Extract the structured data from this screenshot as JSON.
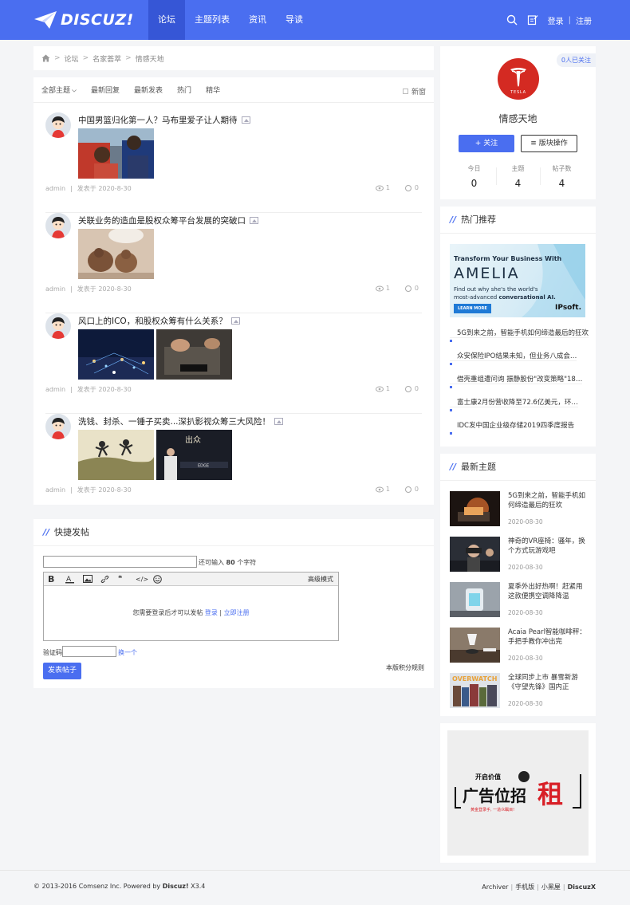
{
  "header": {
    "logo_text": "DISCUZ!",
    "nav": [
      {
        "label": "论坛",
        "active": true
      },
      {
        "label": "主题列表",
        "active": false
      },
      {
        "label": "资讯",
        "active": false
      },
      {
        "label": "导读",
        "active": false
      }
    ],
    "login": "登录",
    "register": "注册",
    "separator": "|",
    "search_icon": "search-icon",
    "post_icon": "edit-icon"
  },
  "breadcrumb": {
    "items": [
      "论坛",
      "名家荟萃",
      "情感天地"
    ],
    "sep": ">"
  },
  "filters": {
    "tabs": [
      "全部主题",
      "最新回复",
      "最新发表",
      "热门",
      "精华"
    ],
    "newest": "新窗"
  },
  "threads": [
    {
      "title": "中国男篮归化第一人？马布里爱子让人期待",
      "author": "admin",
      "date": "发表于 2020-8-30",
      "views": "1",
      "replies": "0"
    },
    {
      "title": "关联业务的造血是股权众筹平台发展的突破口",
      "author": "admin",
      "date": "发表于 2020-8-30",
      "views": "1",
      "replies": "0"
    },
    {
      "title": "风口上的ICO，和股权众筹有什么关系？",
      "author": "admin",
      "date": "发表于 2020-8-30",
      "views": "1",
      "replies": "0"
    },
    {
      "title": "洗钱、封杀、一锤子买卖...深扒影视众筹三大风险！",
      "author": "admin",
      "date": "发表于 2020-8-30",
      "views": "1",
      "replies": "0"
    }
  ],
  "quick_post": {
    "title": "快捷发帖",
    "remain_prefix": "还可输入",
    "remain_count": "80",
    "remain_suffix": "个字符",
    "advanced": "高级模式",
    "login_msg": "您需要登录后才可以发帖",
    "login_link": "登录",
    "sep": "|",
    "register_link": "立即注册",
    "captcha_label": "验证码",
    "captcha_refresh": "换一个",
    "rules": "本版积分规则",
    "submit": "发表帖子"
  },
  "forum": {
    "followers": "0人已关注",
    "logo_text": "TESLA",
    "name": "情感天地",
    "follow": "+ 关注",
    "ops": "≡ 版块操作",
    "stats": [
      {
        "label": "今日",
        "value": "0"
      },
      {
        "label": "主题",
        "value": "4"
      },
      {
        "label": "帖子数",
        "value": "4"
      }
    ]
  },
  "hot": {
    "title": "热门推荐",
    "banner": {
      "line1": "Transform Your Business With",
      "brand": "AMELIA",
      "line3a": "Find out why she's the world's",
      "line3b": "most-advanced",
      "line3c": "conversational AI.",
      "cta": "LEARN MORE",
      "company": "IPsoft."
    },
    "items": [
      "5G到来之前，智能手机如何缔造最后的狂欢",
      "众安保险IPO结果未知，但业务八成会…",
      "借壳重组遭问询 振静股份\"改变策略\"18…",
      "富士康2月份营收降至72.6亿美元，环…",
      "IDC发中国企业级存储2019四季度报告"
    ]
  },
  "latest": {
    "title": "最新主题",
    "items": [
      {
        "title": "5G到来之前，智能手机如何缔造最后的狂欢",
        "date": "2020-08-30"
      },
      {
        "title": "神奇的VR座椅：骚年，换个方式玩游戏吧",
        "date": "2020-08-30"
      },
      {
        "title": "夏季外出好热啊！赶紧用这款便携空调降降温",
        "date": "2020-08-30"
      },
      {
        "title": "Acaia Pearl智能咖啡秤：手把手教你冲出完",
        "date": "2020-08-30"
      },
      {
        "title": "全球同步上市 暴雪新游《守望先锋》国内正",
        "date": "2020-08-30"
      }
    ]
  },
  "ad": {
    "small": "开启价值",
    "main": "广告位招",
    "big": "租",
    "sub": "黄金登录手, 一造众瞩目!"
  },
  "footer": {
    "copyright": "© 2013-2016 Comsenz Inc. Powered by",
    "brand": "Discuz!",
    "version": "X3.4",
    "links": [
      "Archiver",
      "手机版",
      "小黑屋"
    ],
    "sep": "|",
    "right_brand": "DiscuzX"
  },
  "colors": {
    "primary": "#4a6ef0",
    "primary_dark": "#3656d6",
    "tesla_red": "#d42a22"
  }
}
